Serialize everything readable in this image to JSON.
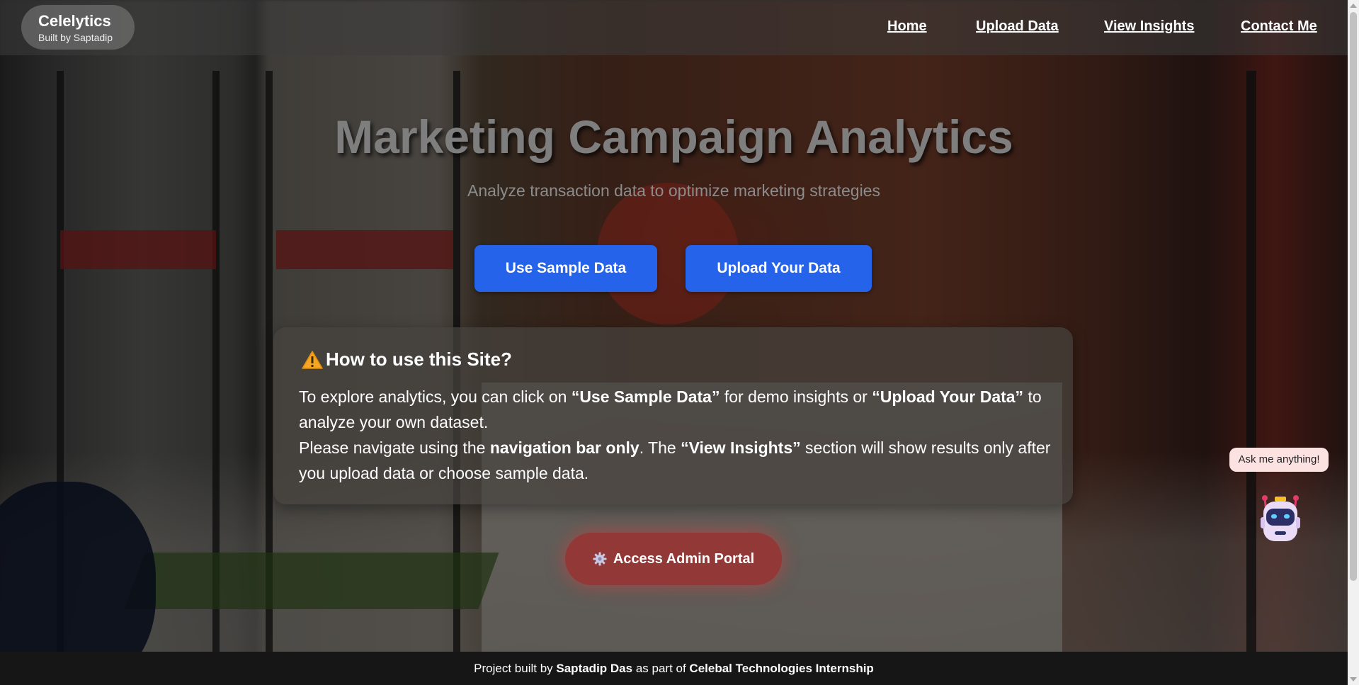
{
  "brand": {
    "title": "Celelytics",
    "subtitle": "Built by Saptadip"
  },
  "nav": {
    "items": [
      {
        "label": "Home"
      },
      {
        "label": "Upload Data"
      },
      {
        "label": "View Insights"
      },
      {
        "label": "Contact Me"
      }
    ]
  },
  "hero": {
    "title": "Marketing Campaign Analytics",
    "subtitle": "Analyze transaction data to optimize marketing strategies",
    "primary_button": "Use Sample Data",
    "secondary_button": "Upload Your Data"
  },
  "info": {
    "icon": "warning-icon",
    "heading": "How to use this Site?",
    "p1_a": "To explore analytics, you can click on ",
    "p1_b": "“Use Sample Data”",
    "p1_c": " for demo insights or ",
    "p1_d": "“Upload Your Data”",
    "p1_e": " to analyze your own dataset.",
    "p2_a": "Please navigate using the ",
    "p2_b": "navigation bar only",
    "p2_c": ". The ",
    "p2_d": "“View Insights”",
    "p2_e": " section will show results only after you upload data or choose sample data."
  },
  "admin": {
    "icon": "gear-icon",
    "label": "Access Admin Portal"
  },
  "chatbot": {
    "prompt": "Ask me anything!",
    "icon": "robot-icon"
  },
  "footer": {
    "prefix": "Project built by ",
    "author": "Saptadip Das",
    "middle": " as part of ",
    "program": "Celebal Technologies Internship"
  },
  "colors": {
    "primary_button": "#2563eb",
    "admin_button": "#9b3232",
    "chat_bubble": "#fde2e2",
    "footer": "#161616"
  }
}
